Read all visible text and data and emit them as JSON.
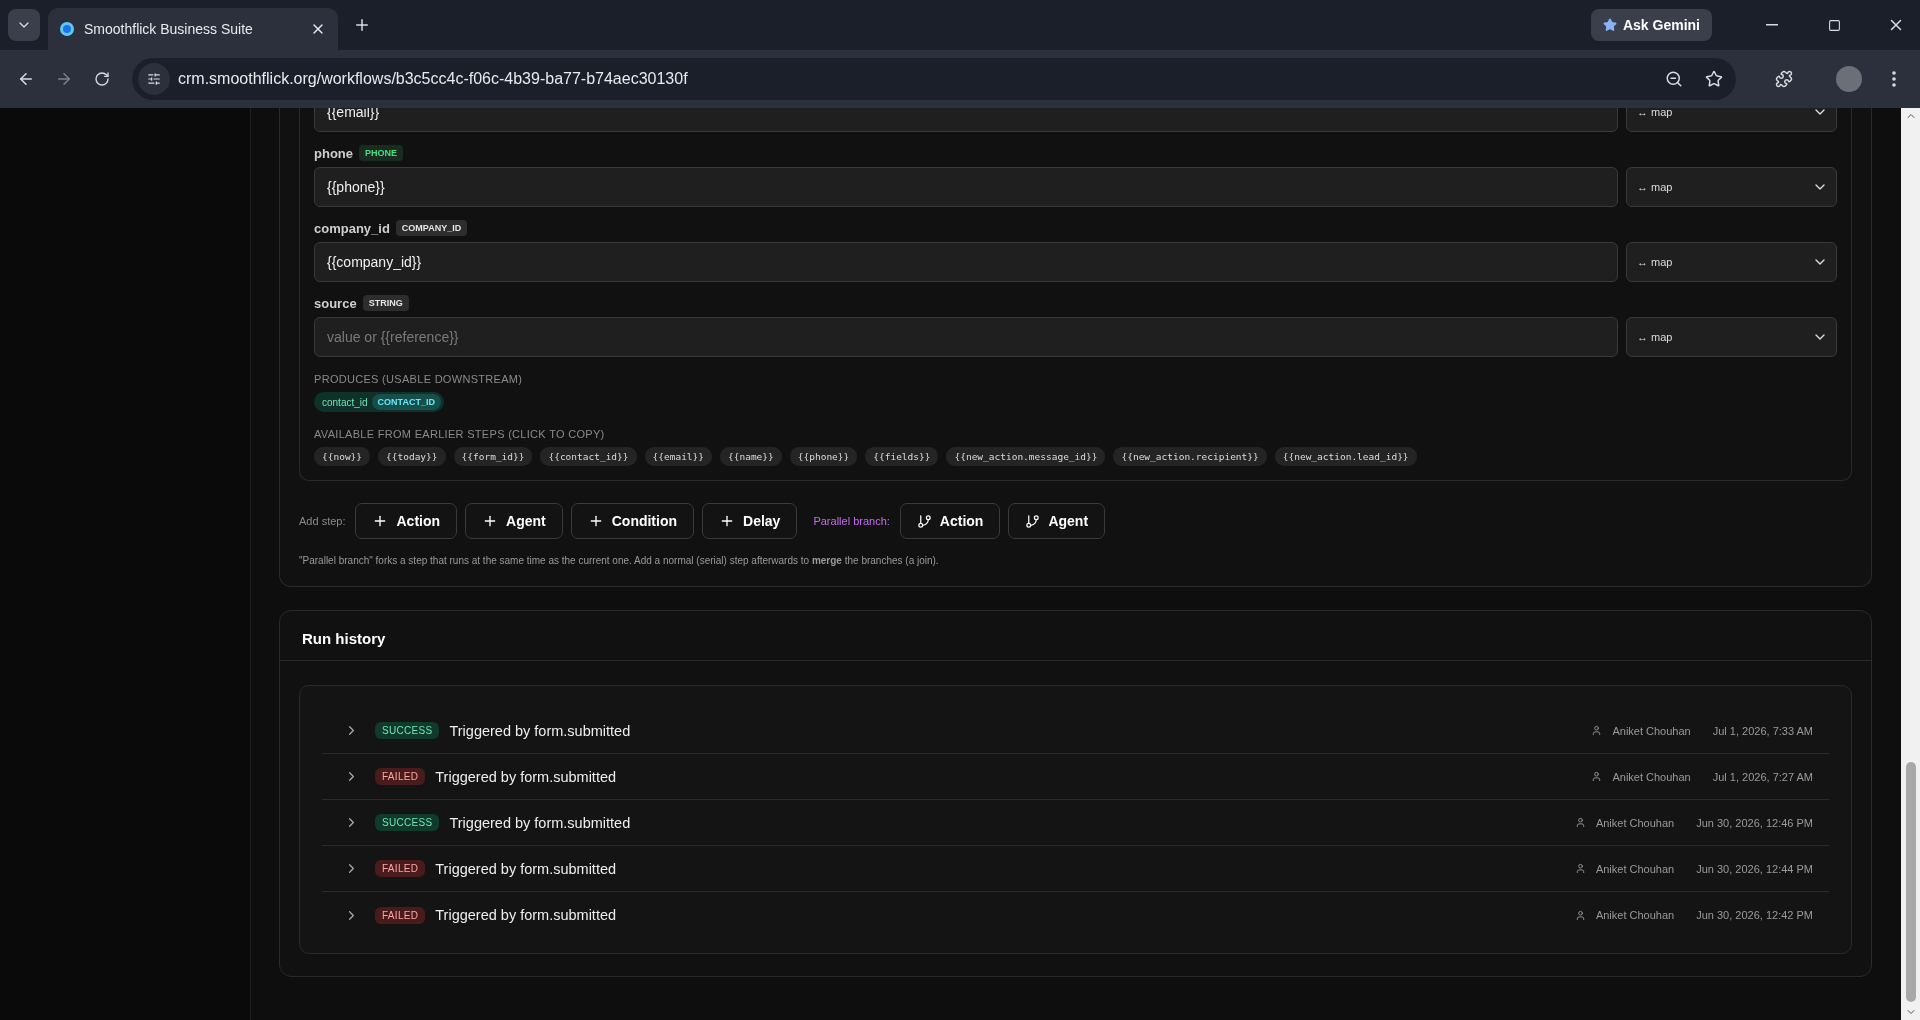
{
  "browser": {
    "tab_title": "Smoothflick Business Suite",
    "url": "crm.smoothflick.org/workflows/b3c5cc4c-f06c-4b39-ba77-b74aec30130f",
    "ask_gemini": "Ask Gemini"
  },
  "fields": [
    {
      "value": "{{email}}",
      "map": "↔ map"
    },
    {
      "label": "phone",
      "type": "PHONE",
      "color": "#4ade80",
      "value": "{{phone}}",
      "map": "↔ map"
    },
    {
      "label": "company_id",
      "type": "COMPANY_ID",
      "color": "#e5e5e5",
      "value": "{{company_id}}",
      "map": "↔ map"
    },
    {
      "label": "source",
      "type": "STRING",
      "color": "#e5e5e5",
      "placeholder": "value or {{reference}}",
      "map": "↔ map"
    }
  ],
  "produces": {
    "label": "PRODUCES (USABLE DOWNSTREAM)",
    "outputs": [
      {
        "name": "contact_id",
        "type": "CONTACT_ID"
      }
    ]
  },
  "available": {
    "label": "AVAILABLE FROM EARLIER STEPS (CLICK TO COPY)",
    "tokens": [
      "{{now}}",
      "{{today}}",
      "{{form_id}}",
      "{{contact_id}}",
      "{{email}}",
      "{{name}}",
      "{{phone}}",
      "{{fields}}",
      "{{new_action.message_id}}",
      "{{new_action.recipient}}",
      "{{new_action.lead_id}}"
    ]
  },
  "add_step": {
    "label": "Add step:",
    "buttons": [
      {
        "label": "Action"
      },
      {
        "label": "Agent"
      },
      {
        "label": "Condition"
      },
      {
        "label": "Delay"
      }
    ],
    "parallel_label": "Parallel branch:",
    "parallel_buttons": [
      {
        "label": "Action"
      },
      {
        "label": "Agent"
      }
    ]
  },
  "note": "\"Parallel branch\" forks a step that runs at the same time as the current one. Add a normal (serial) step afterwards to **merge** the branches (a join).",
  "run_history": {
    "title": "Run history",
    "runs": [
      {
        "status": "SUCCESS",
        "kind": "success",
        "trigger": "Triggered by form.submitted",
        "user": "Aniket Chouhan",
        "time": "Jul 1, 2026, 7:33 AM"
      },
      {
        "status": "FAILED",
        "kind": "failed",
        "trigger": "Triggered by form.submitted",
        "user": "Aniket Chouhan",
        "time": "Jul 1, 2026, 7:27 AM"
      },
      {
        "status": "SUCCESS",
        "kind": "success",
        "trigger": "Triggered by form.submitted",
        "user": "Aniket Chouhan",
        "time": "Jun 30, 2026, 12:46 PM"
      },
      {
        "status": "FAILED",
        "kind": "failed",
        "trigger": "Triggered by form.submitted",
        "user": "Aniket Chouhan",
        "time": "Jun 30, 2026, 12:44 PM"
      },
      {
        "status": "FAILED",
        "kind": "failed",
        "trigger": "Triggered by form.submitted",
        "user": "Aniket Chouhan",
        "time": "Jun 30, 2026, 12:42 PM"
      }
    ]
  }
}
